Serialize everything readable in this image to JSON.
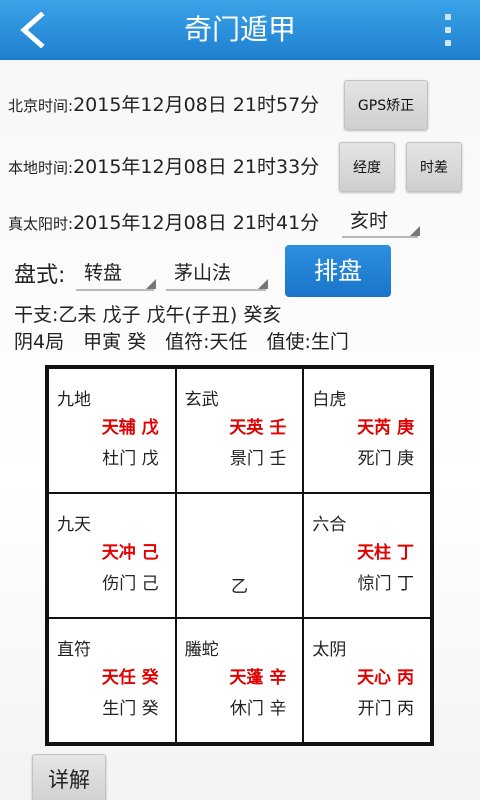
{
  "header": {
    "title": "奇门遁甲",
    "back_icon": "chevron-left-icon",
    "menu_icon": "overflow-menu-icon"
  },
  "times": {
    "beijing": {
      "label": "北京时间:",
      "value": "2015年12月08日 21时57分",
      "button": "GPS矫正"
    },
    "local": {
      "label": "本地时间:",
      "value": "2015年12月08日 21时33分",
      "button_longitude": "经度",
      "button_timediff": "时差"
    },
    "solar": {
      "label": "真太阳时:",
      "value": "2015年12月08日 21时41分",
      "shichen": "亥时"
    }
  },
  "panshi": {
    "label": "盘式:",
    "type": "转盘",
    "method": "茅山法",
    "button": "排盘"
  },
  "info": {
    "ganzhi": "干支:乙未 戊子 戊午(子丑) 癸亥",
    "ju": "阴4局　甲寅 癸　值符:天任　值使:生门"
  },
  "palaces": [
    {
      "god": "九地",
      "star": "天辅 戊",
      "gate": "杜门 戊"
    },
    {
      "god": "玄武",
      "star": "天英 壬",
      "gate": "景门 壬"
    },
    {
      "god": "白虎",
      "star": "天芮 庚",
      "gate": "死门 庚"
    },
    {
      "god": "九天",
      "star": "天冲 己",
      "gate": "伤门 己"
    },
    {
      "center": "乙"
    },
    {
      "god": "六合",
      "star": "天柱 丁",
      "gate": "惊门 丁"
    },
    {
      "god": "直符",
      "star": "天任 癸",
      "gate": "生门 癸"
    },
    {
      "god": "螣蛇",
      "star": "天蓬 辛",
      "gate": "休门 辛"
    },
    {
      "god": "太阴",
      "star": "天心 丙",
      "gate": "开门 丙"
    }
  ],
  "footer": {
    "detail_button": "详解"
  },
  "colors": {
    "topbar": "#1f7fcf",
    "star_text": "#e00000",
    "paipan_button": "#1a75c9"
  }
}
